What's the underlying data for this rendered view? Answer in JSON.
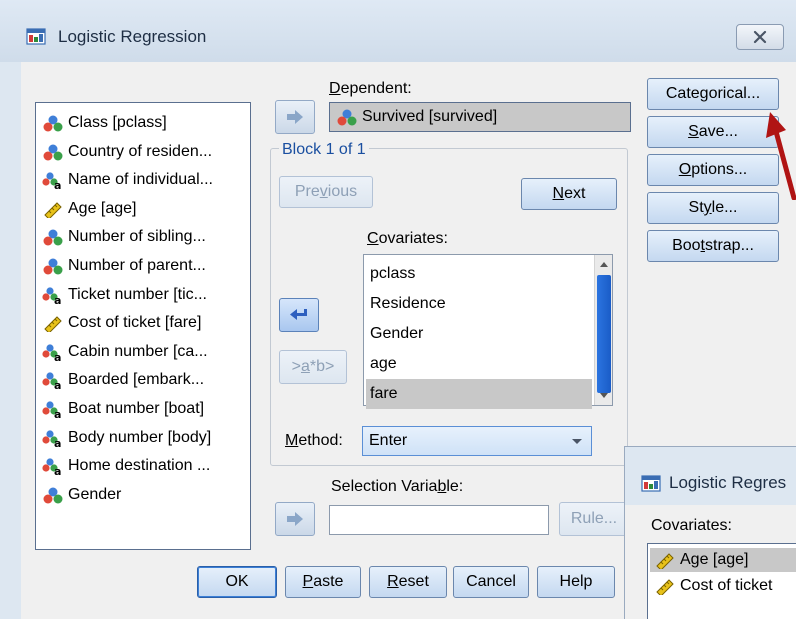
{
  "window": {
    "title": "Logistic Regression"
  },
  "variables": [
    {
      "label": "Class [pclass]",
      "icon": "nominal-icon"
    },
    {
      "label": "Country of residen...",
      "icon": "nominal-icon"
    },
    {
      "label": "Name of individual...",
      "icon": "string-nominal-icon"
    },
    {
      "label": "Age [age]",
      "icon": "scale-icon"
    },
    {
      "label": "Number of sibling...",
      "icon": "nominal-icon"
    },
    {
      "label": "Number of parent...",
      "icon": "nominal-icon"
    },
    {
      "label": "Ticket number [tic...",
      "icon": "string-nominal-icon"
    },
    {
      "label": "Cost of ticket [fare]",
      "icon": "scale-icon"
    },
    {
      "label": "Cabin number [ca...",
      "icon": "string-nominal-icon"
    },
    {
      "label": "Boarded [embark...",
      "icon": "string-nominal-icon"
    },
    {
      "label": "Boat number [boat]",
      "icon": "string-nominal-icon"
    },
    {
      "label": "Body number [body]",
      "icon": "string-nominal-icon"
    },
    {
      "label": "Home destination ...",
      "icon": "string-nominal-icon"
    },
    {
      "label": "Gender",
      "icon": "nominal-icon"
    }
  ],
  "dependent": {
    "label_pre": "",
    "label_u": "D",
    "label_post": "ependent:",
    "value": "Survived [survived]"
  },
  "block": {
    "title": "Block 1 of 1",
    "previous_pre": "Pre",
    "previous_u": "v",
    "previous_post": "ious",
    "next_pre": "",
    "next_u": "N",
    "next_post": "ext"
  },
  "covariates": {
    "label_u": "C",
    "label_post": "ovariates:",
    "items": [
      "pclass",
      "Residence",
      "Gender",
      "age",
      "fare"
    ],
    "selected_index": 4
  },
  "interaction_button": {
    "pre": ">",
    "u": "a",
    "post": "*b>"
  },
  "method": {
    "label_pre": "",
    "label_u": "M",
    "label_post": "ethod:",
    "value": "Enter"
  },
  "selection_variable": {
    "label_pre": "Selection Varia",
    "label_u": "b",
    "label_post": "le:",
    "value": "",
    "rule_label": "Rule..."
  },
  "side_buttons": [
    {
      "pre": "Cate",
      "u": "g",
      "post": "orical..."
    },
    {
      "pre": "",
      "u": "S",
      "post": "ave..."
    },
    {
      "pre": "",
      "u": "O",
      "post": "ptions..."
    },
    {
      "pre": "St",
      "u": "y",
      "post": "le..."
    },
    {
      "pre": "Boo",
      "u": "t",
      "post": "strap..."
    }
  ],
  "bottom_buttons": {
    "ok": "OK",
    "paste_pre": "",
    "paste_u": "P",
    "paste_post": "aste",
    "reset_pre": "",
    "reset_u": "R",
    "reset_post": "eset",
    "cancel": "Cancel",
    "help": "Help"
  },
  "overlay_dialog": {
    "title": "Logistic Regres",
    "covariates_label": "Covariates:",
    "items": [
      "Age [age]",
      "Cost of ticket"
    ]
  },
  "colors": {
    "annotation_arrow": "#b01414",
    "selection": "#c8c8c8",
    "accent": "#1a4fa0"
  }
}
